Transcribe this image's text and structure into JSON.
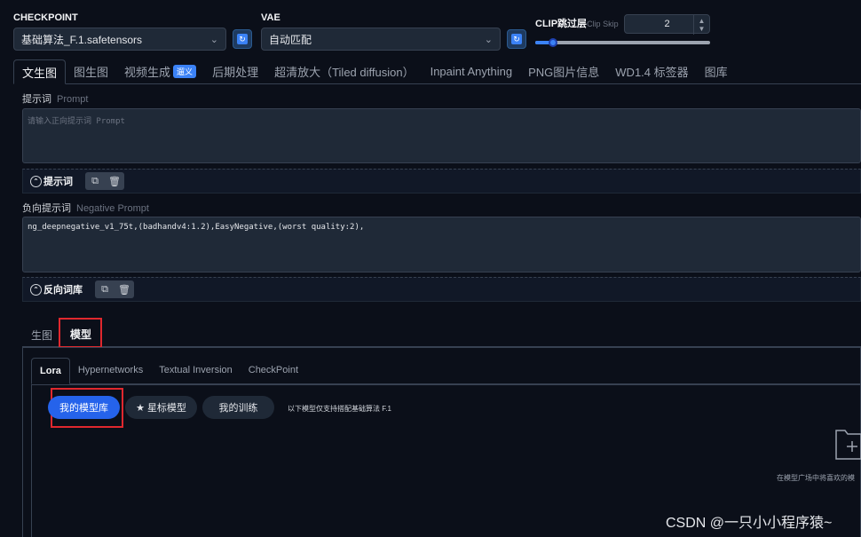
{
  "checkpoint": {
    "label": "CHECKPOINT",
    "value": "基础算法_F.1.safetensors"
  },
  "vae": {
    "label": "VAE",
    "value": "自动匹配"
  },
  "clip": {
    "label": "CLIP跳过层",
    "sublabel": "Clip Skip",
    "value": "2",
    "slider_fraction": 0.1
  },
  "tabs": [
    {
      "label": "文生图",
      "active": true
    },
    {
      "label": "图生图"
    },
    {
      "label": "视频生成",
      "badge": "遛义"
    },
    {
      "label": "后期处理"
    },
    {
      "label": "超清放大（Tiled diffusion）"
    },
    {
      "label": "Inpaint Anything"
    },
    {
      "label": "PNG图片信息"
    },
    {
      "label": "WD1.4 标签器"
    },
    {
      "label": "图库"
    }
  ],
  "prompt": {
    "label": "提示词",
    "sublabel": "Prompt",
    "placeholder": "请输入正向提示词 Prompt",
    "toggle_label": "提示词"
  },
  "negative": {
    "label": "负向提示词",
    "sublabel": "Negative Prompt",
    "value": "ng_deepnegative_v1_75t,(badhandv4:1.2),EasyNegative,(worst quality:2),",
    "toggle_label": "反向词库"
  },
  "subtabs": [
    "生图",
    "模型"
  ],
  "model_tabs": [
    "Lora",
    "Hypernetworks",
    "Textual Inversion",
    "CheckPoint"
  ],
  "filters": {
    "mine": "我的模型库",
    "starred": "星标模型",
    "training": "我的训练",
    "note": "以下模型仅支持搭配基础算法 F.1"
  },
  "empty_hint": "在模型广场中将喜欢的模",
  "watermark": "CSDN @一只小小程序猿~",
  "colors": {
    "accent": "#2563eb",
    "highlight": "#e0282e",
    "background": "#0b0f19"
  }
}
